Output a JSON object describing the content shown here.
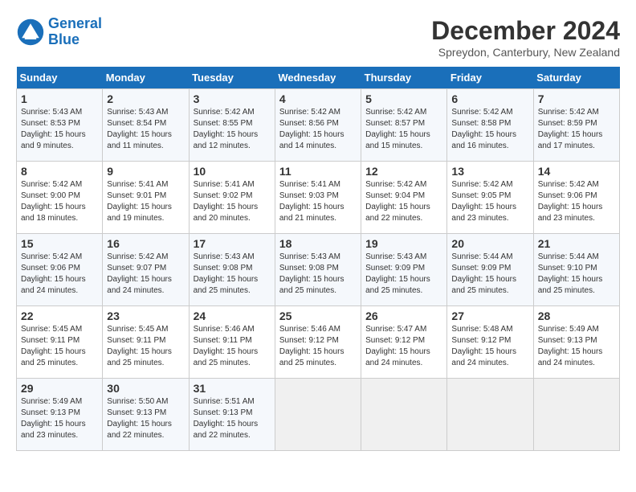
{
  "logo": {
    "line1": "General",
    "line2": "Blue"
  },
  "title": "December 2024",
  "location": "Spreydon, Canterbury, New Zealand",
  "days_of_week": [
    "Sunday",
    "Monday",
    "Tuesday",
    "Wednesday",
    "Thursday",
    "Friday",
    "Saturday"
  ],
  "weeks": [
    [
      {
        "day": 1,
        "info": "Sunrise: 5:43 AM\nSunset: 8:53 PM\nDaylight: 15 hours\nand 9 minutes."
      },
      {
        "day": 2,
        "info": "Sunrise: 5:43 AM\nSunset: 8:54 PM\nDaylight: 15 hours\nand 11 minutes."
      },
      {
        "day": 3,
        "info": "Sunrise: 5:42 AM\nSunset: 8:55 PM\nDaylight: 15 hours\nand 12 minutes."
      },
      {
        "day": 4,
        "info": "Sunrise: 5:42 AM\nSunset: 8:56 PM\nDaylight: 15 hours\nand 14 minutes."
      },
      {
        "day": 5,
        "info": "Sunrise: 5:42 AM\nSunset: 8:57 PM\nDaylight: 15 hours\nand 15 minutes."
      },
      {
        "day": 6,
        "info": "Sunrise: 5:42 AM\nSunset: 8:58 PM\nDaylight: 15 hours\nand 16 minutes."
      },
      {
        "day": 7,
        "info": "Sunrise: 5:42 AM\nSunset: 8:59 PM\nDaylight: 15 hours\nand 17 minutes."
      }
    ],
    [
      {
        "day": 8,
        "info": "Sunrise: 5:42 AM\nSunset: 9:00 PM\nDaylight: 15 hours\nand 18 minutes."
      },
      {
        "day": 9,
        "info": "Sunrise: 5:41 AM\nSunset: 9:01 PM\nDaylight: 15 hours\nand 19 minutes."
      },
      {
        "day": 10,
        "info": "Sunrise: 5:41 AM\nSunset: 9:02 PM\nDaylight: 15 hours\nand 20 minutes."
      },
      {
        "day": 11,
        "info": "Sunrise: 5:41 AM\nSunset: 9:03 PM\nDaylight: 15 hours\nand 21 minutes."
      },
      {
        "day": 12,
        "info": "Sunrise: 5:42 AM\nSunset: 9:04 PM\nDaylight: 15 hours\nand 22 minutes."
      },
      {
        "day": 13,
        "info": "Sunrise: 5:42 AM\nSunset: 9:05 PM\nDaylight: 15 hours\nand 23 minutes."
      },
      {
        "day": 14,
        "info": "Sunrise: 5:42 AM\nSunset: 9:06 PM\nDaylight: 15 hours\nand 23 minutes."
      }
    ],
    [
      {
        "day": 15,
        "info": "Sunrise: 5:42 AM\nSunset: 9:06 PM\nDaylight: 15 hours\nand 24 minutes."
      },
      {
        "day": 16,
        "info": "Sunrise: 5:42 AM\nSunset: 9:07 PM\nDaylight: 15 hours\nand 24 minutes."
      },
      {
        "day": 17,
        "info": "Sunrise: 5:43 AM\nSunset: 9:08 PM\nDaylight: 15 hours\nand 25 minutes."
      },
      {
        "day": 18,
        "info": "Sunrise: 5:43 AM\nSunset: 9:08 PM\nDaylight: 15 hours\nand 25 minutes."
      },
      {
        "day": 19,
        "info": "Sunrise: 5:43 AM\nSunset: 9:09 PM\nDaylight: 15 hours\nand 25 minutes."
      },
      {
        "day": 20,
        "info": "Sunrise: 5:44 AM\nSunset: 9:09 PM\nDaylight: 15 hours\nand 25 minutes."
      },
      {
        "day": 21,
        "info": "Sunrise: 5:44 AM\nSunset: 9:10 PM\nDaylight: 15 hours\nand 25 minutes."
      }
    ],
    [
      {
        "day": 22,
        "info": "Sunrise: 5:45 AM\nSunset: 9:11 PM\nDaylight: 15 hours\nand 25 minutes."
      },
      {
        "day": 23,
        "info": "Sunrise: 5:45 AM\nSunset: 9:11 PM\nDaylight: 15 hours\nand 25 minutes."
      },
      {
        "day": 24,
        "info": "Sunrise: 5:46 AM\nSunset: 9:11 PM\nDaylight: 15 hours\nand 25 minutes."
      },
      {
        "day": 25,
        "info": "Sunrise: 5:46 AM\nSunset: 9:12 PM\nDaylight: 15 hours\nand 25 minutes."
      },
      {
        "day": 26,
        "info": "Sunrise: 5:47 AM\nSunset: 9:12 PM\nDaylight: 15 hours\nand 24 minutes."
      },
      {
        "day": 27,
        "info": "Sunrise: 5:48 AM\nSunset: 9:12 PM\nDaylight: 15 hours\nand 24 minutes."
      },
      {
        "day": 28,
        "info": "Sunrise: 5:49 AM\nSunset: 9:13 PM\nDaylight: 15 hours\nand 24 minutes."
      }
    ],
    [
      {
        "day": 29,
        "info": "Sunrise: 5:49 AM\nSunset: 9:13 PM\nDaylight: 15 hours\nand 23 minutes."
      },
      {
        "day": 30,
        "info": "Sunrise: 5:50 AM\nSunset: 9:13 PM\nDaylight: 15 hours\nand 22 minutes."
      },
      {
        "day": 31,
        "info": "Sunrise: 5:51 AM\nSunset: 9:13 PM\nDaylight: 15 hours\nand 22 minutes."
      },
      null,
      null,
      null,
      null
    ]
  ]
}
